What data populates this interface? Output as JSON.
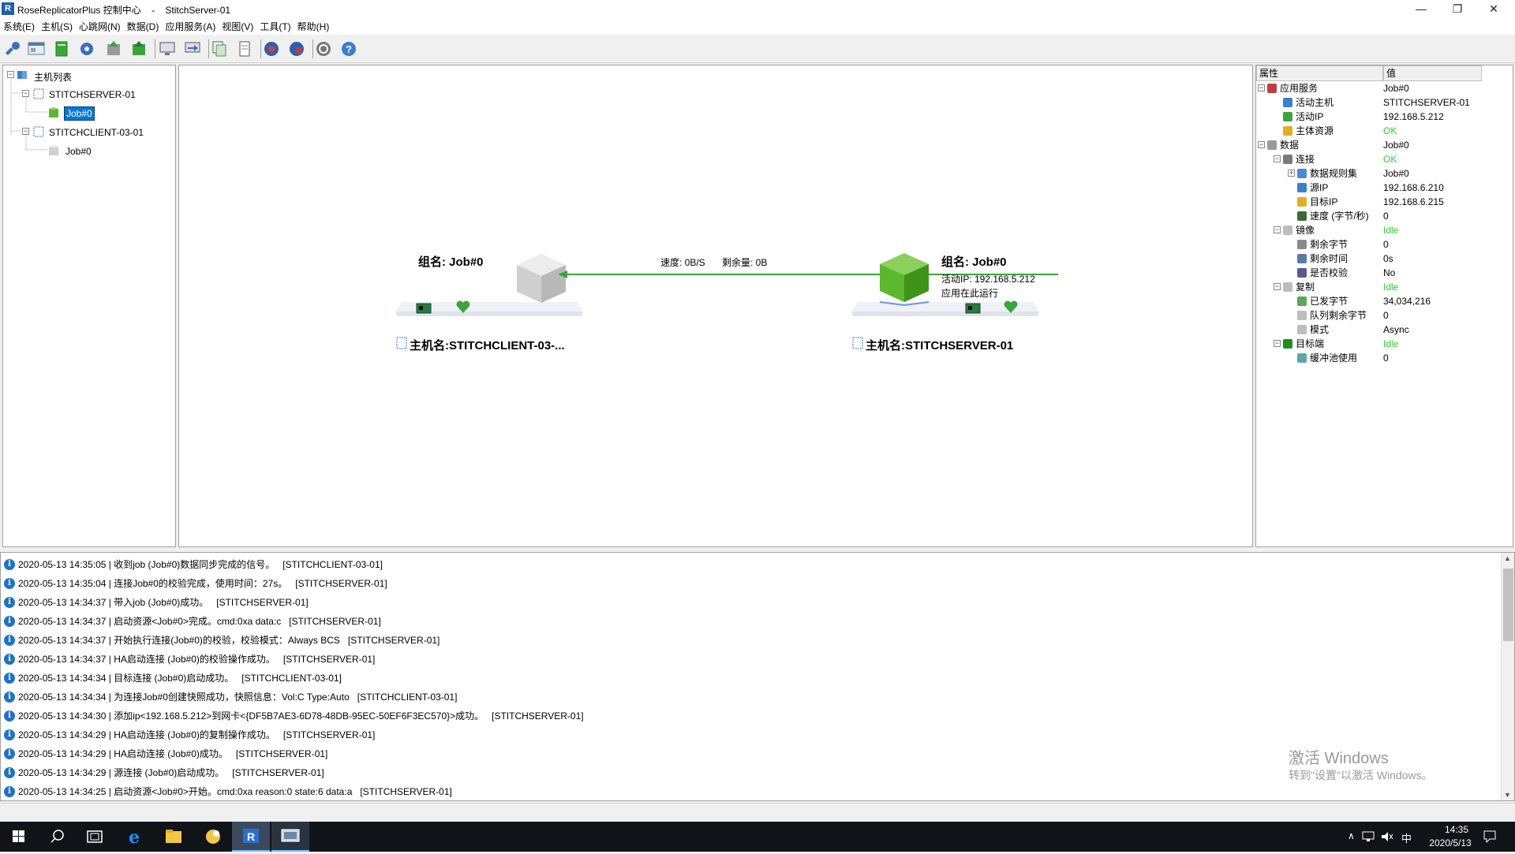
{
  "window": {
    "title": "RoseReplicatorPlus 控制中心    -    StitchServer-01",
    "controls": {
      "minimize": "—",
      "restore": "❐",
      "close": "✕"
    }
  },
  "menu": [
    "系统(E)",
    "主机(S)",
    "心跳网(N)",
    "数据(D)",
    "应用服务(A)",
    "视图(V)",
    "工具(T)",
    "帮助(H)"
  ],
  "toolbar_icons": [
    "key-icon",
    "console-icon",
    "server-icon",
    "gear-icon",
    "import-icon",
    "export-icon",
    "monitor-icon",
    "monitor-arrow-icon",
    "copy-icon",
    "document-icon",
    "globe-icon",
    "network-icon",
    "refresh-icon",
    "help-icon"
  ],
  "tree": {
    "root": "主机列表",
    "hosts": [
      {
        "name": "STITCHSERVER-01",
        "job": "Job#0",
        "active": true
      },
      {
        "name": "STITCHCLIENT-03-01",
        "job": "Job#0",
        "active": false
      }
    ]
  },
  "canvas": {
    "left_node": {
      "group_label": "组名: Job#0",
      "host_label": "主机名:STITCHCLIENT-03-..."
    },
    "right_node": {
      "group_label": "组名: Job#0",
      "active_ip_label": "活动IP:  192.168.5.212",
      "running_label": "应用在此运行",
      "host_label": "主机名:STITCHSERVER-01"
    },
    "link": {
      "speed_label": "速度:   0B/S",
      "remaining_label": "剩余量:   0B"
    },
    "colors": {
      "link": "#3aa53a",
      "active_cube": "#5cb82c",
      "inactive_cube": "#d0d0d0"
    }
  },
  "props": {
    "headers": {
      "name": "属性",
      "value": "值"
    },
    "rows": [
      {
        "name": "应用服务",
        "value": "Job#0",
        "level": 0,
        "exp": "−",
        "icon": "#c23b3b"
      },
      {
        "name": "活动主机",
        "value": "STITCHSERVER-01",
        "level": 1,
        "exp": "",
        "icon": "#3a7fd0"
      },
      {
        "name": "活动IP",
        "value": "192.168.5.212",
        "level": 1,
        "exp": "",
        "icon": "#3aa53a"
      },
      {
        "name": "主体资源",
        "value": "OK",
        "level": 1,
        "exp": "",
        "icon": "#e0b020",
        "green": true
      },
      {
        "name": "数据",
        "value": "Job#0",
        "level": 0,
        "exp": "−",
        "icon": "#9a9a9a"
      },
      {
        "name": "连接",
        "value": "OK",
        "level": 1,
        "exp": "−",
        "icon": "#7a7a7a",
        "green": true
      },
      {
        "name": "数据规则集",
        "value": "Job#0",
        "level": 2,
        "exp": "+",
        "icon": "#4a8ad8"
      },
      {
        "name": "源IP",
        "value": "192.168.6.210",
        "level": 2,
        "exp": "",
        "icon": "#3a7fd0"
      },
      {
        "name": "目标IP",
        "value": "192.168.6.215",
        "level": 2,
        "exp": "",
        "icon": "#e0b020"
      },
      {
        "name": "速度 (字节/秒)",
        "value": "0",
        "level": 2,
        "exp": "",
        "icon": "#3a6a3a"
      },
      {
        "name": "镜像",
        "value": "Idle",
        "level": 1,
        "exp": "−",
        "icon": "#bdbdbd",
        "green": true
      },
      {
        "name": "剩余字节",
        "value": "0",
        "level": 2,
        "exp": "",
        "icon": "#8a8a8a"
      },
      {
        "name": "剩余时间",
        "value": "0s",
        "level": 2,
        "exp": "",
        "icon": "#5a7aa8"
      },
      {
        "name": "是否校验",
        "value": "No",
        "level": 2,
        "exp": "",
        "icon": "#5a5a8a"
      },
      {
        "name": "复制",
        "value": "Idle",
        "level": 1,
        "exp": "−",
        "icon": "#bdbdbd",
        "green": true
      },
      {
        "name": "已发字节",
        "value": "34,034,216",
        "level": 2,
        "exp": "",
        "icon": "#5aa85a"
      },
      {
        "name": "队列剩余字节",
        "value": "0",
        "level": 2,
        "exp": "",
        "icon": "#bdbdbd"
      },
      {
        "name": "模式",
        "value": "Async",
        "level": 2,
        "exp": "",
        "icon": "#bdbdbd"
      },
      {
        "name": "目标端",
        "value": "Idle",
        "level": 1,
        "exp": "−",
        "icon": "#1f8f1f",
        "green": true
      },
      {
        "name": "缓冲池使用",
        "value": "0",
        "level": 2,
        "exp": "",
        "icon": "#5aa8a8"
      }
    ]
  },
  "log": [
    "2020-05-13 14:35:05 | 收到job (Job#0)数据同步完成的信号。   [STITCHCLIENT-03-01]",
    "2020-05-13 14:35:04 | 连接Job#0的校验完成，使用时间：27s。   [STITCHSERVER-01]",
    "2020-05-13 14:34:37 | 带入job (Job#0)成功。   [STITCHSERVER-01]",
    "2020-05-13 14:34:37 | 启动资源<Job#0>完成。cmd:0xa data:c   [STITCHSERVER-01]",
    "2020-05-13 14:34:37 | 开始执行连接(Job#0)的校验，校验模式：Always BCS   [STITCHSERVER-01]",
    "2020-05-13 14:34:37 | HA启动连接 (Job#0)的校验操作成功。   [STITCHSERVER-01]",
    "2020-05-13 14:34:34 | 目标连接 (Job#0)启动成功。   [STITCHCLIENT-03-01]",
    "2020-05-13 14:34:34 | 为连接Job#0创建快照成功，快照信息：Vol:C Type:Auto   [STITCHCLIENT-03-01]",
    "2020-05-13 14:34:30 | 添加ip<192.168.5.212>到网卡<{DF5B7AE3-6D78-48DB-95EC-50EF6F3EC570}>成功。   [STITCHSERVER-01]",
    "2020-05-13 14:34:29 | HA启动连接 (Job#0)的复制操作成功。   [STITCHSERVER-01]",
    "2020-05-13 14:34:29 | HA启动连接 (Job#0)成功。   [STITCHSERVER-01]",
    "2020-05-13 14:34:29 | 源连接 (Job#0)启动成功。   [STITCHSERVER-01]",
    "2020-05-13 14:34:25 | 启动资源<Job#0>开始。cmd:0xa reason:0 state:6 data:a   [STITCHSERVER-01]"
  ],
  "watermark": {
    "line1": "激活 Windows",
    "line2": "转到\"设置\"以激活 Windows。"
  },
  "taskbar": {
    "apps": [
      "start-icon",
      "search-icon",
      "task-view-icon",
      "ie-icon",
      "explorer-icon",
      "rose-app-icon",
      "rr-app-icon",
      "console-app-icon"
    ],
    "time": "14:35",
    "date": "2020/5/13",
    "tray": {
      "chevron": "∧",
      "ime": "中"
    }
  }
}
